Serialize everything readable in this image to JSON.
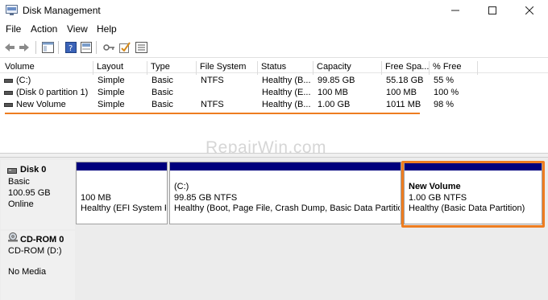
{
  "window": {
    "title": "Disk Management"
  },
  "menu": [
    "File",
    "Action",
    "View",
    "Help"
  ],
  "columns": [
    "Volume",
    "Layout",
    "Type",
    "File System",
    "Status",
    "Capacity",
    "Free Spa...",
    "% Free"
  ],
  "volumes": [
    {
      "volume": "(C:)",
      "layout": "Simple",
      "type": "Basic",
      "fs": "NTFS",
      "status": "Healthy (B...",
      "capacity": "99.85 GB",
      "free": "55.18 GB",
      "pct": "55 %"
    },
    {
      "volume": "(Disk 0 partition 1)",
      "layout": "Simple",
      "type": "Basic",
      "fs": "",
      "status": "Healthy (E...",
      "capacity": "100 MB",
      "free": "100 MB",
      "pct": "100 %"
    },
    {
      "volume": "New Volume",
      "layout": "Simple",
      "type": "Basic",
      "fs": "NTFS",
      "status": "Healthy (B...",
      "capacity": "1.00 GB",
      "free": "1011 MB",
      "pct": "98 %"
    }
  ],
  "watermark": "RepairWin.com",
  "disk0": {
    "name": "Disk 0",
    "type": "Basic",
    "size": "100.95 GB",
    "state": "Online",
    "partitions": [
      {
        "title": "",
        "size": "100 MB",
        "status": "Healthy (EFI System P"
      },
      {
        "title": "(C:)",
        "size": "99.85 GB NTFS",
        "status": "Healthy (Boot, Page File, Crash Dump, Basic Data Partition)"
      },
      {
        "title": "New Volume",
        "size": "1.00 GB NTFS",
        "status": "Healthy (Basic Data Partition)"
      }
    ]
  },
  "cdrom0": {
    "name": "CD-ROM 0",
    "drive": "CD-ROM (D:)",
    "media": "No Media"
  },
  "colors": {
    "accent": "#ee7d20",
    "partition_bar": "#00007d"
  },
  "icons": [
    "disk-management-icon",
    "minimize-icon",
    "maximize-icon",
    "close-icon",
    "back-arrow-icon",
    "forward-arrow-icon",
    "console-tree-icon",
    "properties-icon",
    "help-icon",
    "view-icon",
    "check-icon",
    "settings-icon",
    "volume-icon",
    "disk-icon",
    "cdrom-icon"
  ]
}
